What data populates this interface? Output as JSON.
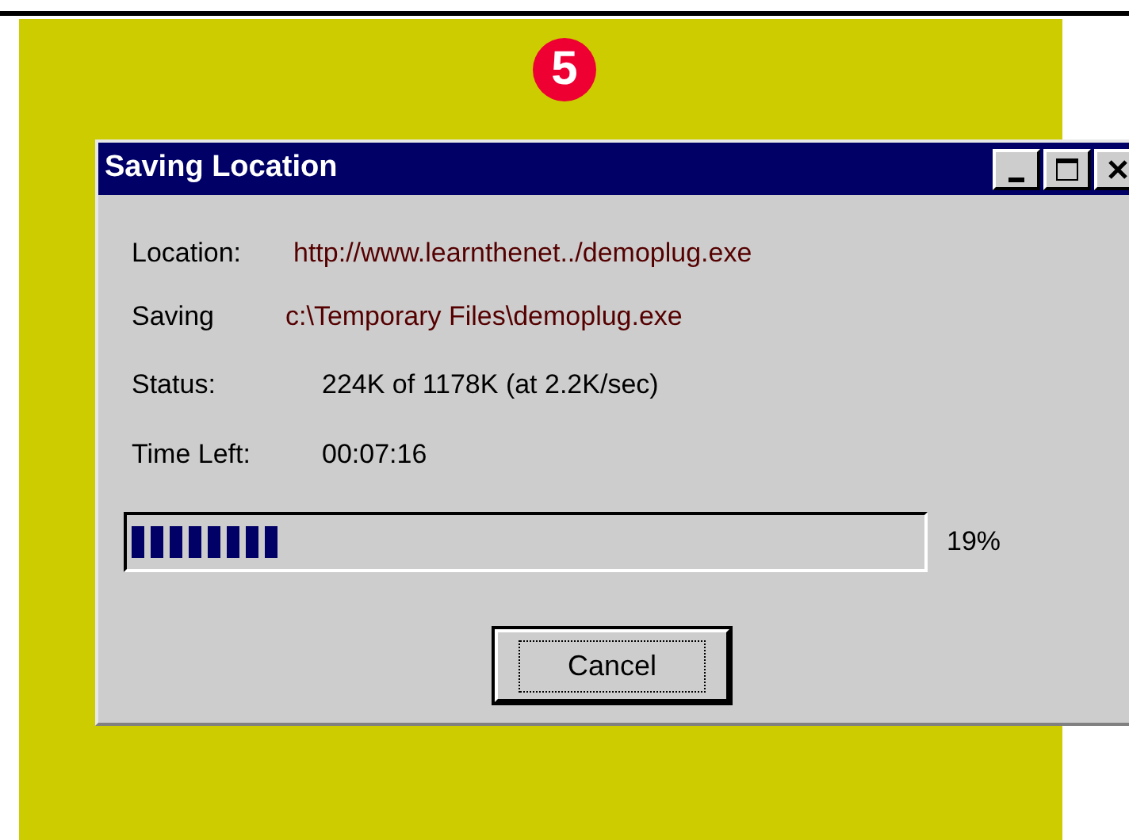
{
  "step_badge": "5",
  "window": {
    "title": "Saving Location"
  },
  "fields": [
    {
      "label": "Location:",
      "value": "http://www.learnthenet../demoplug.exe",
      "kind": "path"
    },
    {
      "label": "Saving",
      "value": "c:\\Temporary Files\\demoplug.exe",
      "kind": "path"
    },
    {
      "label": "Status:",
      "value": "224K of 1178K (at 2.2K/sec)",
      "kind": "plain"
    },
    {
      "label": "Time Left:",
      "value": "00:07:16",
      "kind": "plain"
    }
  ],
  "progress": {
    "level": 0.19,
    "reading": "19%"
  },
  "buttons": [
    {
      "label": "Cancel",
      "focused": true
    }
  ]
}
